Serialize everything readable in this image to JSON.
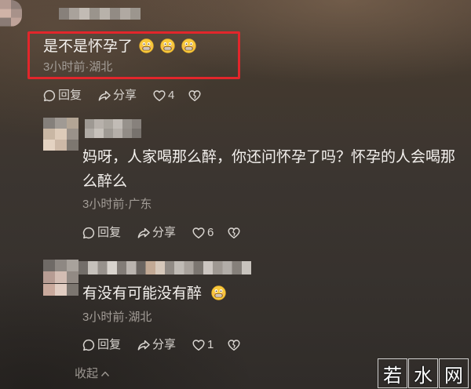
{
  "comments": [
    {
      "text": "是不是怀孕了",
      "emojis": [
        "smiling-face-emoji",
        "smiling-face-emoji",
        "smiling-face-emoji"
      ],
      "meta": "3小时前·湖北",
      "reply_label": "回复",
      "share_label": "分享",
      "like_count": "4",
      "highlighted": true
    },
    {
      "text": "妈呀，人家喝那么醉，你还问怀孕了吗？怀孕的人会喝那么醉么",
      "emojis": [],
      "meta": "3小时前·广东",
      "reply_label": "回复",
      "share_label": "分享",
      "like_count": "6"
    },
    {
      "text": "有没有可能没有醉",
      "emojis": [
        "smiling-face-emoji"
      ],
      "meta": "3小时前·湖北",
      "reply_label": "回复",
      "share_label": "分享",
      "like_count": "1"
    }
  ],
  "footer": {
    "collapse_label": "收起"
  },
  "watermark": {
    "chars": [
      "若",
      "水",
      "网"
    ]
  },
  "icons": {
    "reply": "comment-icon",
    "share": "share-icon",
    "like": "heart-icon",
    "dislike": "broken-heart-icon",
    "collapse": "chevron-up-icon"
  },
  "colors": {
    "highlight": "#e2262b",
    "text_primary": "#f4f1ee",
    "text_secondary": "#a39d97",
    "text_action": "#d9d5d0",
    "text_collapse": "#9d9892"
  }
}
